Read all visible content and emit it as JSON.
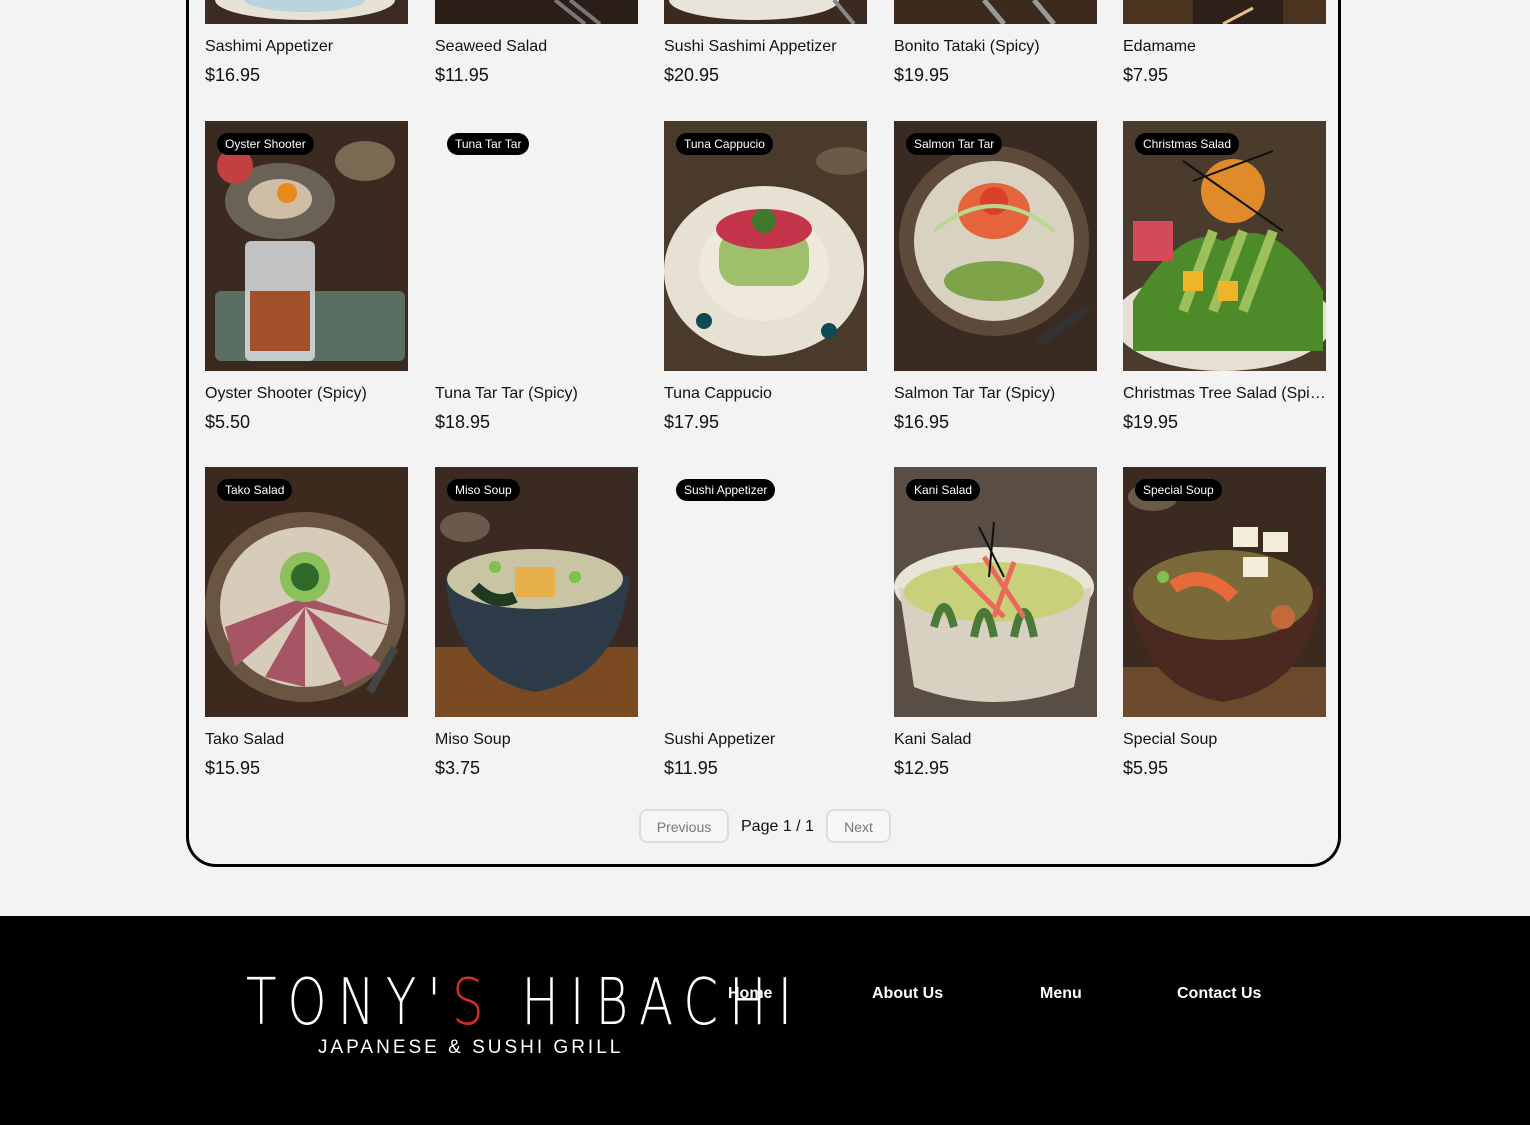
{
  "menu": {
    "row1": [
      {
        "name": "Sashimi Appetizer",
        "price": "$16.95"
      },
      {
        "name": "Seaweed Salad",
        "price": "$11.95"
      },
      {
        "name": "Sushi Sashimi Appetizer",
        "price": "$20.95"
      },
      {
        "name": "Bonito Tataki (Spicy)",
        "price": "$19.95"
      },
      {
        "name": "Edamame",
        "price": "$7.95"
      }
    ],
    "row2": [
      {
        "tag": "Oyster Shooter",
        "name": "Oyster Shooter (Spicy)",
        "price": "$5.50"
      },
      {
        "tag": "Tuna Tar Tar",
        "name": "Tuna Tar Tar (Spicy)",
        "price": "$18.95"
      },
      {
        "tag": "Tuna Cappucio",
        "name": "Tuna Cappucio",
        "price": "$17.95"
      },
      {
        "tag": "Salmon Tar Tar",
        "name": "Salmon Tar Tar (Spicy)",
        "price": "$16.95"
      },
      {
        "tag": "Christmas Salad",
        "name": "Christmas Tree Salad (Spicy)",
        "price": "$19.95"
      }
    ],
    "row3": [
      {
        "tag": "Tako Salad",
        "name": "Tako Salad",
        "price": "$15.95"
      },
      {
        "tag": "Miso Soup",
        "name": "Miso Soup",
        "price": "$3.75"
      },
      {
        "tag": "Sushi Appetizer",
        "name": "Sushi Appetizer",
        "price": "$11.95"
      },
      {
        "tag": "Kani Salad",
        "name": "Kani Salad",
        "price": "$12.95"
      },
      {
        "tag": "Special Soup",
        "name": "Special Soup",
        "price": "$5.95"
      }
    ]
  },
  "pagination": {
    "previous": "Previous",
    "page": "Page 1 / 1",
    "next": "Next"
  },
  "footer": {
    "logo_part1": "TONY'",
    "logo_accent": "S",
    "logo_part2": " HIBACHI",
    "logo_sub": "JAPANESE & SUSHI GRILL",
    "links": [
      "Home",
      "About Us",
      "Menu",
      "Contact Us"
    ]
  },
  "colors": {
    "accent": "#d62b2b",
    "footer_bg": "#000000",
    "page_bg": "#f3f3f3"
  }
}
